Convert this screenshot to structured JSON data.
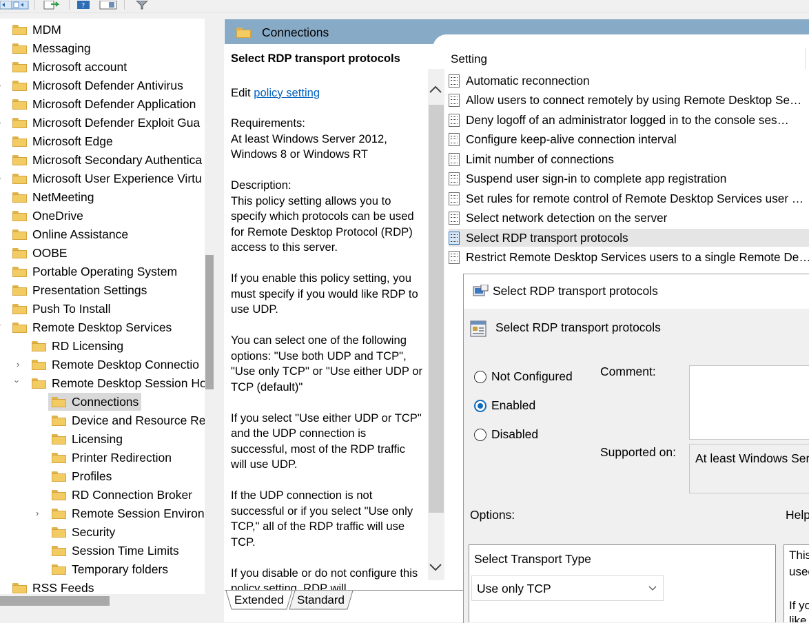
{
  "toolbar": {
    "icons": [
      "back-icon",
      "forward-icon",
      "show-hide-tree-icon",
      "export-icon",
      "help-icon",
      "properties-view-icon",
      "filter-icon"
    ]
  },
  "tree": {
    "items": [
      {
        "label": "MDM"
      },
      {
        "label": "Messaging"
      },
      {
        "label": "Microsoft account"
      },
      {
        "label": "Microsoft Defender Antivirus"
      },
      {
        "label": "Microsoft Defender Application"
      },
      {
        "label": "Microsoft Defender Exploit Gua"
      },
      {
        "label": "Microsoft Edge"
      },
      {
        "label": "Microsoft Secondary Authentica"
      },
      {
        "label": "Microsoft User Experience Virtu"
      },
      {
        "label": "NetMeeting"
      },
      {
        "label": "OneDrive"
      },
      {
        "label": "Online Assistance"
      },
      {
        "label": "OOBE"
      },
      {
        "label": "Portable Operating System"
      },
      {
        "label": "Presentation Settings"
      },
      {
        "label": "Push To Install"
      },
      {
        "label": "Remote Desktop Services"
      },
      {
        "label": "RD Licensing"
      },
      {
        "label": "Remote Desktop Connectio"
      },
      {
        "label": "Remote Desktop Session Ho"
      },
      {
        "label": "Connections"
      },
      {
        "label": "Device and Resource Re"
      },
      {
        "label": "Licensing"
      },
      {
        "label": "Printer Redirection"
      },
      {
        "label": "Profiles"
      },
      {
        "label": "RD Connection Broker"
      },
      {
        "label": "Remote Session Environ"
      },
      {
        "label": "Security"
      },
      {
        "label": "Session Time Limits"
      },
      {
        "label": "Temporary folders"
      },
      {
        "label": "RSS Feeds"
      }
    ]
  },
  "panel": {
    "header_title": "Connections",
    "desc": {
      "title": "Select RDP transport protocols",
      "edit_prefix": "Edit ",
      "edit_link": "policy setting ",
      "requirements_label": "Requirements:",
      "requirements_text": "At least Windows Server 2012, Windows 8 or Windows RT",
      "description_label": "Description:",
      "paragraphs": [
        "This policy setting allows you to specify which protocols can be used for Remote Desktop Protocol (RDP) access to this server.",
        "If you enable this policy setting, you must specify if you would like RDP to use UDP.",
        "You can select one of the following options: \"Use both UDP and TCP\", \"Use only TCP\" or \"Use either UDP or TCP (default)\"",
        "If you select \"Use either UDP or TCP\" and the UDP connection is successful, most of the RDP traffic will use UDP.",
        "If the UDP connection is not successful or if you select \"Use only TCP,\" all of the RDP traffic will use TCP.",
        "If you disable or do not configure this policy setting, RDP will"
      ]
    },
    "list_header": "Setting",
    "settings": [
      "Automatic reconnection",
      "Allow users to connect remotely by using Remote Desktop Se…",
      "Deny logoff of an administrator logged in to the console ses…",
      "Configure keep-alive connection interval",
      "Limit number of connections",
      "Suspend user sign-in to complete app registration",
      "Set rules for remote control of Remote Desktop Services user …",
      "Select network detection on the server",
      "Select RDP transport protocols",
      "Restrict Remote Desktop Services users to a single Remote De…"
    ],
    "tabs": [
      "Extended",
      "Standard"
    ]
  },
  "dialog": {
    "window_title": "Select RDP transport protocols",
    "policy_title": "Select RDP transport protocols",
    "radio_not_configured": "Not Configured",
    "radio_enabled": "Enabled",
    "radio_disabled": "Disabled",
    "selected_state": "Enabled",
    "comment_label": "Comment:",
    "supported_label": "Supported on:",
    "supported_value": "At least Windows Serv",
    "options_label": "Options:",
    "help_label": "Help",
    "transport_label": "Select Transport Type",
    "transport_value": "Use only TCP",
    "help_text_1": "This",
    "help_text_2": "usec",
    "help_text_3": "If yo",
    "help_text_4": "like"
  },
  "colors": {
    "header_blue": "#87aac6",
    "link": "#0563c1",
    "radio_accent": "#0f6cbd"
  }
}
